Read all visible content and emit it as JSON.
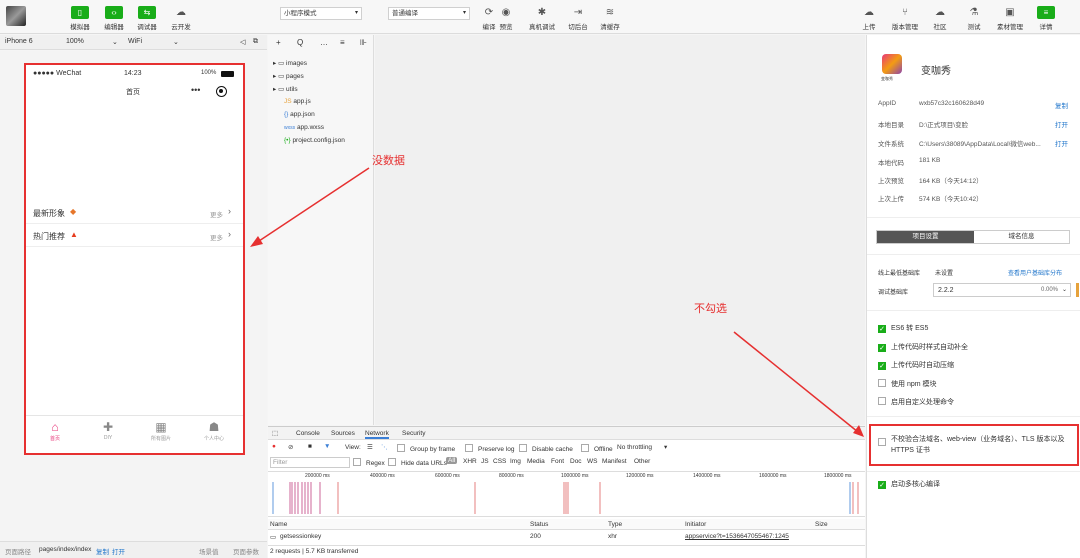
{
  "toolbar": {
    "left_buttons": [
      {
        "label": "模拟器",
        "icon": "phone-icon"
      },
      {
        "label": "编辑器",
        "icon": "code-icon"
      },
      {
        "label": "调试器",
        "icon": "debug-icon"
      },
      {
        "label": "云开发",
        "icon": "cloud-icon"
      }
    ],
    "mode_select": "小程序模式",
    "compile_select": "普通编译",
    "mid_buttons": [
      "编译",
      "预览",
      "真机调试",
      "切后台",
      "清缓存"
    ],
    "right_buttons": [
      "上传",
      "版本管理",
      "社区",
      "测试",
      "素材管理",
      "详情"
    ]
  },
  "simbar": {
    "device": "iPhone 6",
    "zoom": "100%",
    "network": "WiFi"
  },
  "phone": {
    "carrier": "●●●●● WeChat",
    "time": "14:23",
    "battery": "100%",
    "nav_title": "首页",
    "rows": [
      {
        "label": "最新形象",
        "more": "更多"
      },
      {
        "label": "热门推荐",
        "more": "更多"
      }
    ],
    "tabs": [
      "首页",
      "DIY",
      "所有图片",
      "个人中心"
    ]
  },
  "annotations": {
    "no_data": "没数据",
    "no_check": "不勾选"
  },
  "files": {
    "toolbar_icons": [
      "+",
      "Q",
      "…",
      "≡",
      "⊪"
    ],
    "items": [
      "images",
      "pages",
      "utils",
      "app.js",
      "app.json",
      "app.wxss",
      "project.config.json"
    ]
  },
  "devtools": {
    "tabs": [
      "Console",
      "Sources",
      "Network",
      "Security"
    ],
    "filter_row": [
      "View:",
      "Group by frame",
      "Preserve log",
      "Disable cache",
      "Offline",
      "No throttling"
    ],
    "filter_placeholder": "Filter",
    "types": [
      "Regex",
      "Hide data URLs",
      "All",
      "XHR",
      "JS",
      "CSS",
      "Img",
      "Media",
      "Font",
      "Doc",
      "WS",
      "Manifest",
      "Other"
    ],
    "timeline": [
      "200000 ms",
      "400000 ms",
      "600000 ms",
      "800000 ms",
      "1000000 ms",
      "1200000 ms",
      "1400000 ms",
      "1600000 ms",
      "1800000 ms"
    ],
    "columns": [
      "Name",
      "Status",
      "Type",
      "Initiator",
      "Size"
    ],
    "request": {
      "name": "getsessionkey",
      "status": "200",
      "type": "xhr",
      "initiator": "appservice?t=1536647055467:1245"
    },
    "summary": "2 requests | 5.7 KB transferred"
  },
  "bottom": {
    "path_label": "页面路径",
    "path": "pages/index/index",
    "copy": "复制",
    "open": "打开",
    "scene": "场景值",
    "params": "页面参数"
  },
  "panel": {
    "app_name": "变咖秀",
    "logo_text": "变咖秀",
    "info": [
      {
        "k": "AppID",
        "v": "wxb57c32c160628d49",
        "a": "复制"
      },
      {
        "k": "本地目录",
        "v": "D:\\正式项目\\变脸",
        "a": "打开"
      },
      {
        "k": "文件系统",
        "v": "C:\\Users\\38089\\AppData\\Local\\微信web...",
        "a": "打开"
      },
      {
        "k": "本地代码",
        "v": "181 KB",
        "a": ""
      },
      {
        "k": "上次预览",
        "v": "164 KB（今天14:12）",
        "a": ""
      },
      {
        "k": "上次上传",
        "v": "574 KB（今天10:42）",
        "a": ""
      }
    ],
    "tabs": [
      "项目设置",
      "域名信息"
    ],
    "lib_label": "线上最低基础库",
    "lib_value": "未设置",
    "lib_link": "查看用户基础库分布",
    "debug_label": "调试基础库",
    "debug_value": "2.2.2",
    "debug_pct": "0.00%",
    "checks": [
      {
        "label": "ES6 转 ES5",
        "on": true
      },
      {
        "label": "上传代码时样式自动补全",
        "on": true
      },
      {
        "label": "上传代码时自动压缩",
        "on": true
      },
      {
        "label": "使用 npm 模块",
        "on": false
      },
      {
        "label": "启用自定义处理命令",
        "on": false
      }
    ],
    "domain_check": "不校验合法域名、web-view（业务域名）、TLS 版本以及 HTTPS 证书",
    "multicore": "启动多核心编译"
  }
}
